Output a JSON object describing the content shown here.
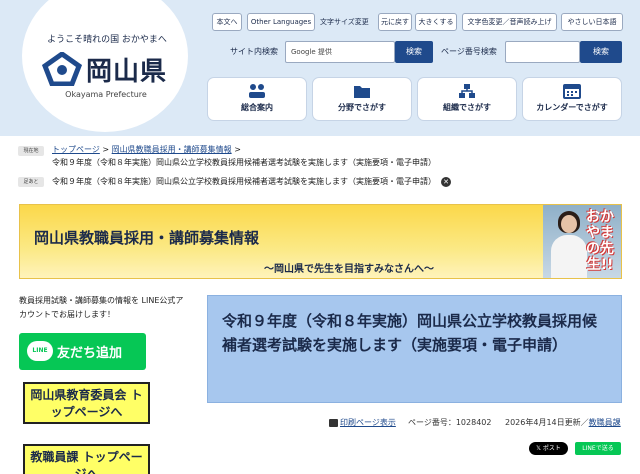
{
  "header": {
    "tagline": "ようこそ晴れの国 おかやまへ",
    "logo_name": "岡山県",
    "logo_en": "Okayama Prefecture",
    "top_links": [
      "本文へ",
      "Other Languages"
    ],
    "font_size_label": "文字サイズ変更",
    "font_buttons": [
      "元に戻す",
      "大きくする"
    ],
    "color_voice": "文字色変更／音声読み上げ",
    "easy_japanese": "やさしい日本語",
    "site_search_label": "サイト内検索",
    "site_search_placeholder": "Google 提供",
    "site_search_button": "検索",
    "page_search_label": "ページ番号検索",
    "page_search_button": "検索",
    "nav": [
      {
        "label": "総合案内",
        "icon": "people-icon"
      },
      {
        "label": "分野でさがす",
        "icon": "folder-icon"
      },
      {
        "label": "組織でさがす",
        "icon": "organization-icon"
      },
      {
        "label": "カレンダーでさがす",
        "icon": "calendar-icon"
      }
    ],
    "accent": "#1f4a8c"
  },
  "breadcrumb": {
    "current_tag": "現在地",
    "home": "トップページ",
    "sep": ">",
    "section": "岡山県教職員採用・講師募集情報",
    "current": "令和９年度（令和８年実施）岡山県公立学校教員採用候補者選考試験を実施します（実施要項・電子申請）",
    "footprint_tag": "足あと",
    "footprint": "令和９年度（令和８年実施）岡山県公立学校教員採用候補者選考試験を実施します（実施要項・電子申請）"
  },
  "banner": {
    "title": "岡山県教職員採用・講師募集情報",
    "subtitle": "～岡山県で先生を目指すみなさんへ～",
    "photo_text": "おかやまの先生!!"
  },
  "sidebar": {
    "line_text": "教員採用試験・講師募集の情報を LINE公式アカウントでお届けします！",
    "line_button": "友だち追加",
    "line_badge": "LINE",
    "board_button": "岡山県教育委員会 トップページへ",
    "staff_button": "教職員課 トップページへ"
  },
  "main": {
    "title": "令和９年度（令和８年実施）岡山県公立学校教員採用候補者選考試験を実施します（実施要項・電子申請）",
    "print": "印刷ページ表示",
    "page_no": "ページ番号：1028402",
    "updated": "2026年4月14日更新／",
    "dept": "教職員課",
    "xpost": "𝕏 ポスト",
    "line_send": "LINEで送る"
  }
}
